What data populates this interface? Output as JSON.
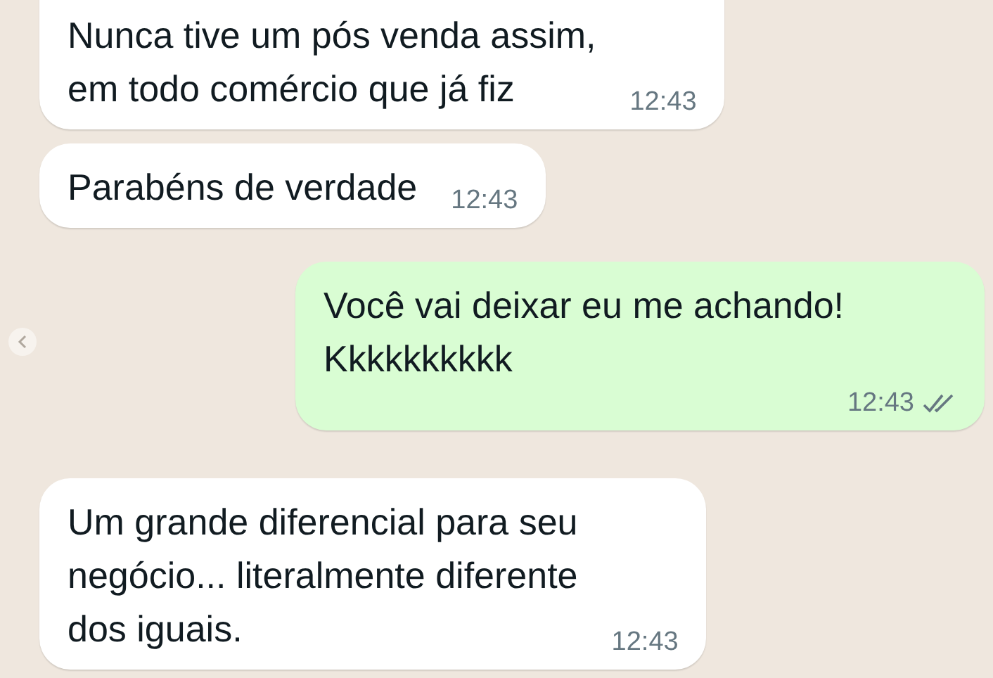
{
  "messages": [
    {
      "kind": "incoming",
      "lines": [
        "Nunca tive um pós venda assim,",
        "em todo comércio que já fiz"
      ],
      "time": "12:43"
    },
    {
      "kind": "incoming",
      "lines": [
        "Parabéns de verdade"
      ],
      "time": "12:43"
    },
    {
      "kind": "outgoing",
      "lines": [
        "Você vai deixar eu me achando!",
        "Kkkkkkkkkk"
      ],
      "time": "12:43",
      "read": false
    },
    {
      "kind": "incoming",
      "lines": [
        "Um grande diferencial para seu",
        "negócio... literalmente diferente",
        "dos iguais."
      ],
      "time": "12:43"
    }
  ]
}
